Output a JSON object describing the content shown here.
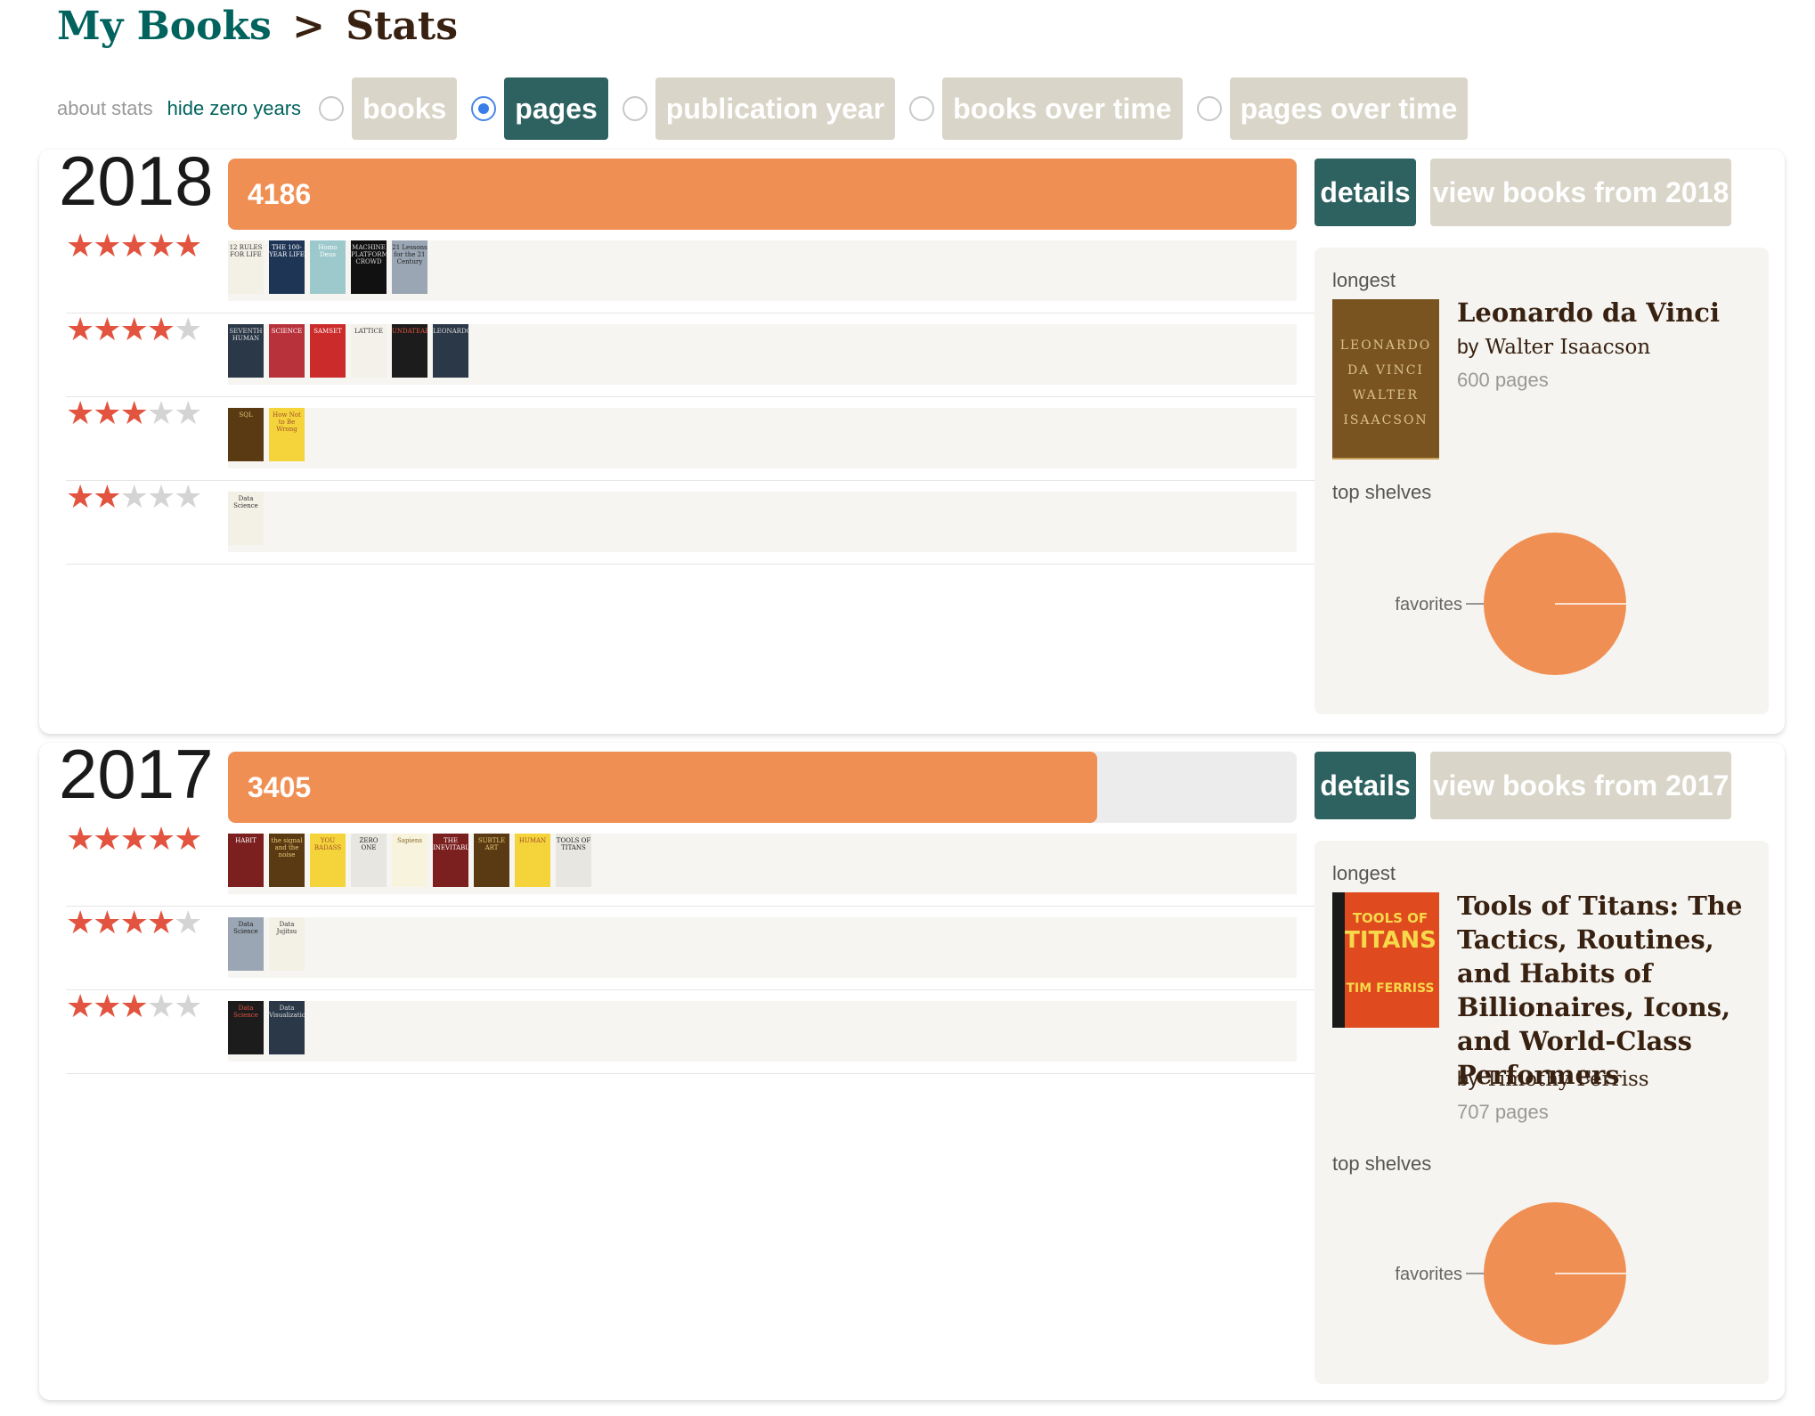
{
  "breadcrumb": {
    "parent": "My Books",
    "separator": ">",
    "current": "Stats"
  },
  "controls": {
    "about_stats": "about stats",
    "hide_zero_years": "hide zero years",
    "options": [
      {
        "label": "books",
        "selected": false
      },
      {
        "label": "pages",
        "selected": true
      },
      {
        "label": "publication year",
        "selected": false
      },
      {
        "label": "books over time",
        "selected": false
      },
      {
        "label": "pages over time",
        "selected": false
      }
    ]
  },
  "colors": {
    "teal": "#2d6261",
    "orange": "#f08f53",
    "star": "#e2543f",
    "tan": "#d9d5c8"
  },
  "years": [
    {
      "year": "2018",
      "pages": "4186",
      "pages_fraction": 1.0,
      "details_label": "details",
      "view_label": "view books from 2018",
      "ratings": [
        {
          "stars": 5,
          "covers": [
            "12 RULES FOR LIFE",
            "THE 100-YEAR LIFE",
            "Homo Deus",
            "MACHINE PLATFORM CROWD",
            "21 Lessons for the 21 Century"
          ]
        },
        {
          "stars": 4,
          "covers": [
            "SEVENTH HUMAN",
            "SCIENCE",
            "SAMSET",
            "LATTICE",
            "UNDATEABLE",
            "LEONARDO"
          ]
        },
        {
          "stars": 3,
          "covers": [
            "SQL",
            "How Not to Be Wrong"
          ]
        },
        {
          "stars": 2,
          "covers": [
            "Data Science"
          ]
        }
      ],
      "longest": {
        "label": "longest",
        "title": "Leonardo da Vinci",
        "author": "Walter Isaacson",
        "by": "by",
        "pages": "600 pages",
        "cover_lines": [
          "LEONARDO",
          "DA VINCI",
          "WALTER",
          "ISAACSON"
        ]
      },
      "top_shelves": {
        "label": "top shelves",
        "slices": [
          {
            "name": "favorites",
            "share": 1.0
          }
        ]
      }
    },
    {
      "year": "2017",
      "pages": "3405",
      "pages_fraction": 0.813,
      "details_label": "details",
      "view_label": "view books from 2017",
      "ratings": [
        {
          "stars": 5,
          "covers": [
            "HABIT",
            "the signal and the noise",
            "YOU BADASS",
            "ZERO ONE",
            "Sapiens",
            "THE INEVITABLE",
            "SUBTLE ART",
            "HUMAN",
            "TOOLS OF TITANS"
          ]
        },
        {
          "stars": 4,
          "covers": [
            "Data Science",
            "Data Jujitsu"
          ]
        },
        {
          "stars": 3,
          "covers": [
            "Data Science",
            "Data Visualization"
          ]
        }
      ],
      "longest": {
        "label": "longest",
        "title": "Tools of Titans: The Tactics, Routines, and Habits of Billionaires, Icons, and World-Class Performers",
        "author": "Timothy Ferriss",
        "by": "by",
        "pages": "707 pages",
        "cover_lines": [
          "TOOLS OF",
          "TITANS",
          "TIM FERRISS"
        ]
      },
      "top_shelves": {
        "label": "top shelves",
        "slices": [
          {
            "name": "favorites",
            "share": 1.0
          }
        ]
      }
    }
  ]
}
